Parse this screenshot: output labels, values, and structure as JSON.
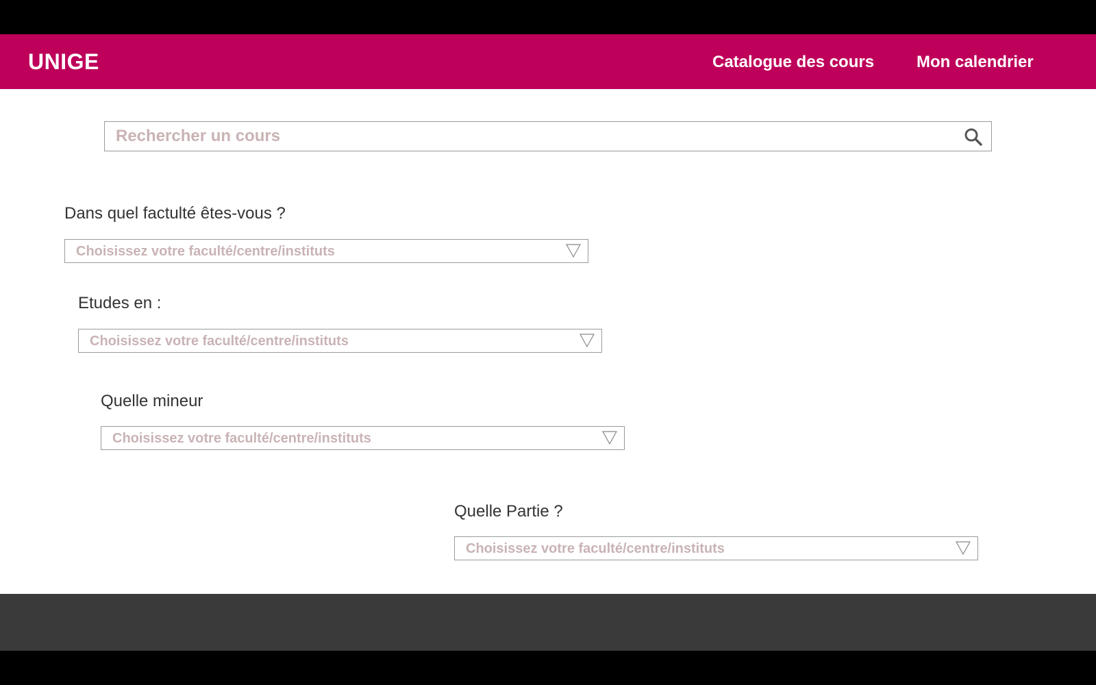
{
  "header": {
    "logo": "UNIGE",
    "nav": {
      "catalogue": "Catalogue des cours",
      "calendar": "Mon calendrier"
    }
  },
  "search": {
    "placeholder": "Rechercher un cours",
    "icon": "search-icon"
  },
  "form": {
    "faculty": {
      "label": "Dans quel factulté êtes-vous ?",
      "value": "Choisissez votre faculté/centre/instituts"
    },
    "studies": {
      "label": "Etudes en :",
      "value": "Choisissez votre faculté/centre/instituts"
    },
    "minor": {
      "label": "Quelle mineur",
      "value": "Choisissez votre faculté/centre/instituts"
    },
    "part": {
      "label": "Quelle Partie ?",
      "value": "Choisissez votre faculté/centre/instituts"
    }
  },
  "colors": {
    "brand": "#be005a",
    "placeholder": "#c9b3b5",
    "footer": "#3a3a3a"
  }
}
